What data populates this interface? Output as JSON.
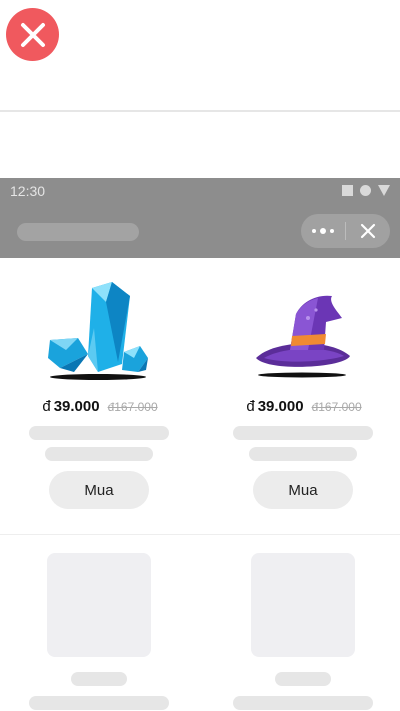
{
  "overlay": {
    "close_icon": "close-icon",
    "close_color": "#f0595e"
  },
  "statusbar": {
    "time": "12:30",
    "icons": [
      "square-icon",
      "circle-icon",
      "triangle-icon"
    ]
  },
  "titlebar": {
    "more_icon": "more-dots-icon",
    "close_icon": "close-icon"
  },
  "products": [
    {
      "icon": "crystal-icon",
      "currency": "đ",
      "price": "39.000",
      "old_price": "đ167.000",
      "button": "Mua"
    },
    {
      "icon": "witch-hat-icon",
      "currency": "đ",
      "price": "39.000",
      "old_price": "đ167.000",
      "button": "Mua"
    }
  ]
}
